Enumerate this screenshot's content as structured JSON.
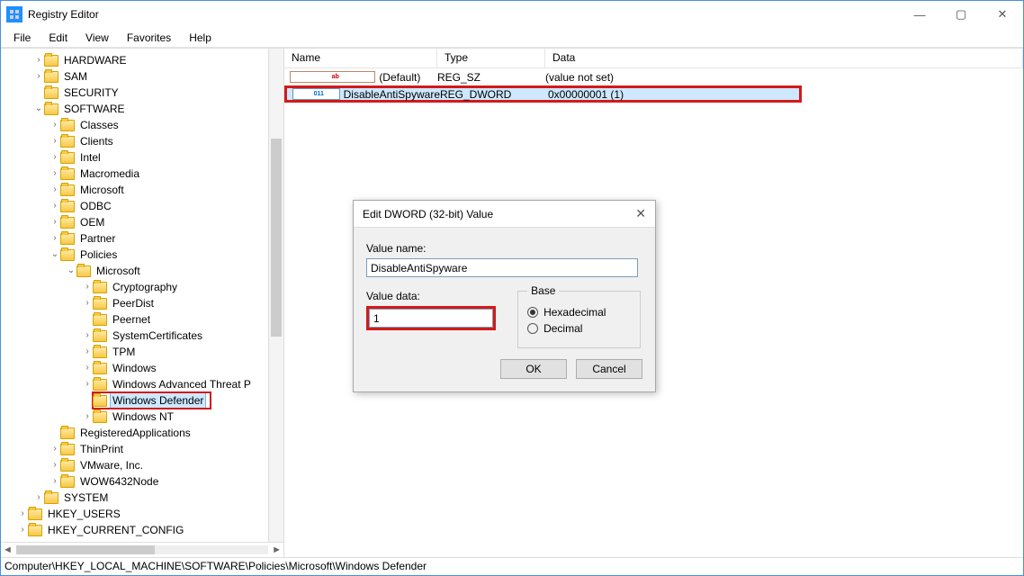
{
  "window": {
    "title": "Registry Editor"
  },
  "menu": [
    "File",
    "Edit",
    "View",
    "Favorites",
    "Help"
  ],
  "tree": [
    {
      "d": 2,
      "e": ">",
      "l": "HARDWARE"
    },
    {
      "d": 2,
      "e": ">",
      "l": "SAM"
    },
    {
      "d": 2,
      "e": "",
      "l": "SECURITY"
    },
    {
      "d": 2,
      "e": "v",
      "l": "SOFTWARE"
    },
    {
      "d": 3,
      "e": ">",
      "l": "Classes"
    },
    {
      "d": 3,
      "e": ">",
      "l": "Clients"
    },
    {
      "d": 3,
      "e": ">",
      "l": "Intel"
    },
    {
      "d": 3,
      "e": ">",
      "l": "Macromedia"
    },
    {
      "d": 3,
      "e": ">",
      "l": "Microsoft"
    },
    {
      "d": 3,
      "e": ">",
      "l": "ODBC"
    },
    {
      "d": 3,
      "e": ">",
      "l": "OEM"
    },
    {
      "d": 3,
      "e": ">",
      "l": "Partner"
    },
    {
      "d": 3,
      "e": "v",
      "l": "Policies"
    },
    {
      "d": 4,
      "e": "v",
      "l": "Microsoft"
    },
    {
      "d": 5,
      "e": ">",
      "l": "Cryptography"
    },
    {
      "d": 5,
      "e": ">",
      "l": "PeerDist"
    },
    {
      "d": 5,
      "e": "",
      "l": "Peernet"
    },
    {
      "d": 5,
      "e": ">",
      "l": "SystemCertificates"
    },
    {
      "d": 5,
      "e": ">",
      "l": "TPM"
    },
    {
      "d": 5,
      "e": ">",
      "l": "Windows"
    },
    {
      "d": 5,
      "e": ">",
      "l": "Windows Advanced Threat P"
    },
    {
      "d": 5,
      "e": "",
      "l": "Windows Defender",
      "sel": true,
      "hi": true
    },
    {
      "d": 5,
      "e": ">",
      "l": "Windows NT"
    },
    {
      "d": 3,
      "e": "",
      "l": "RegisteredApplications"
    },
    {
      "d": 3,
      "e": ">",
      "l": "ThinPrint"
    },
    {
      "d": 3,
      "e": ">",
      "l": "VMware, Inc."
    },
    {
      "d": 3,
      "e": ">",
      "l": "WOW6432Node"
    },
    {
      "d": 2,
      "e": ">",
      "l": "SYSTEM"
    },
    {
      "d": 1,
      "e": ">",
      "l": "HKEY_USERS"
    },
    {
      "d": 1,
      "e": ">",
      "l": "HKEY_CURRENT_CONFIG"
    }
  ],
  "list": {
    "cols": [
      "Name",
      "Type",
      "Data"
    ],
    "rows": [
      {
        "icon": "ab",
        "name": "(Default)",
        "type": "REG_SZ",
        "data": "(value not set)"
      },
      {
        "icon": "bin",
        "name": "DisableAntiSpyware",
        "type": "REG_DWORD",
        "data": "0x00000001 (1)",
        "sel": true,
        "hi": true
      }
    ]
  },
  "dialog": {
    "title": "Edit DWORD (32-bit) Value",
    "valueNameLabel": "Value name:",
    "valueName": "DisableAntiSpyware",
    "valueDataLabel": "Value data:",
    "valueData": "1",
    "baseLabel": "Base",
    "hexLabel": "Hexadecimal",
    "decLabel": "Decimal",
    "baseSelected": "hex",
    "ok": "OK",
    "cancel": "Cancel"
  },
  "status": "Computer\\HKEY_LOCAL_MACHINE\\SOFTWARE\\Policies\\Microsoft\\Windows Defender"
}
